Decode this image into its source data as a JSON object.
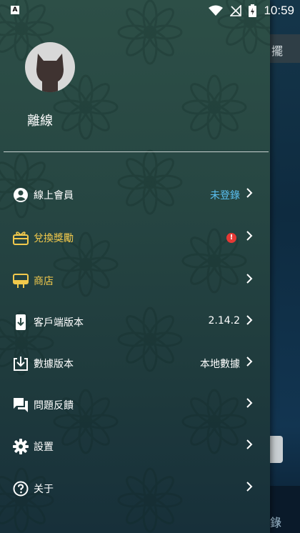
{
  "status_bar": {
    "time": "10:59",
    "app_letter": "A"
  },
  "behind": {
    "top_text": "擺",
    "bottom_text": "錄"
  },
  "profile": {
    "username": "離線"
  },
  "menu": [
    {
      "icon": "account-circle-icon",
      "label": "線上會員",
      "value": "未登錄"
    },
    {
      "icon": "gift-icon",
      "label": "兌換獎勵",
      "badge": "!"
    },
    {
      "icon": "store-icon",
      "label": "商店"
    },
    {
      "icon": "phone-download-icon",
      "label": "客戶端版本",
      "value": "2.14.2"
    },
    {
      "icon": "data-download-icon",
      "label": "數據版本",
      "value": "本地數據"
    },
    {
      "icon": "feedback-icon",
      "label": "問題反饋"
    },
    {
      "icon": "settings-gear-icon",
      "label": "設置"
    },
    {
      "icon": "help-circle-icon",
      "label": "关于"
    }
  ],
  "colors": {
    "accent_gold": "#f2c94c",
    "accent_blue": "#5bc0f2",
    "badge_red": "#e53935"
  }
}
